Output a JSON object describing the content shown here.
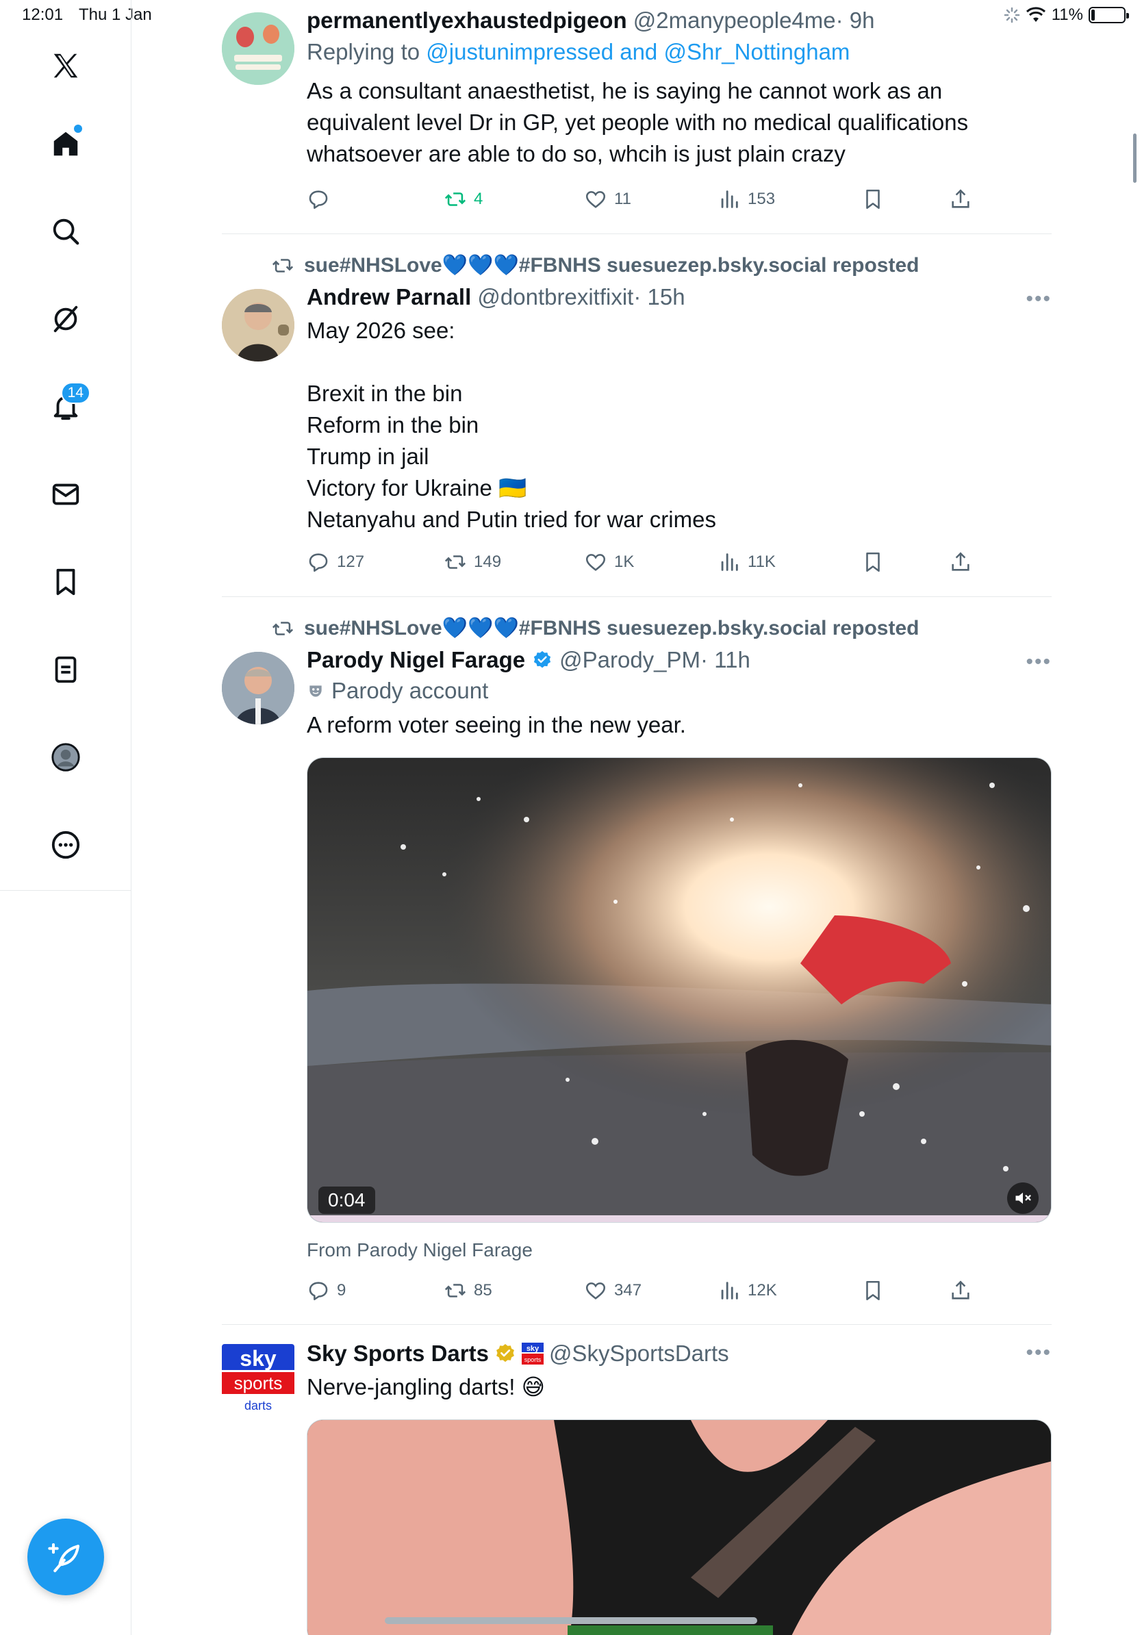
{
  "status_bar": {
    "time": "12:01",
    "date": "Thu 1 Jan",
    "battery": "11%",
    "battery_level": 0.11
  },
  "sidebar": {
    "items": [
      {
        "icon": "x-logo-icon",
        "label": "X"
      },
      {
        "icon": "home-icon",
        "label": "Home"
      },
      {
        "icon": "search-icon",
        "label": "Search"
      },
      {
        "icon": "grok-icon",
        "label": "Grok"
      },
      {
        "icon": "bell-icon",
        "label": "Notifications",
        "badge": "14"
      },
      {
        "icon": "mail-icon",
        "label": "Messages"
      },
      {
        "icon": "bookmark-icon",
        "label": "Bookmarks"
      },
      {
        "icon": "list-icon",
        "label": "Lists"
      },
      {
        "icon": "profile-icon",
        "label": "Profile"
      },
      {
        "icon": "more-icon",
        "label": "More"
      }
    ],
    "compose_icon": "compose-feather-icon"
  },
  "colors": {
    "accent": "#1d9bf0",
    "text": "#0f1419",
    "muted": "#536471",
    "repost_green": "#00ba7c"
  },
  "tweets": [
    {
      "name": "permanentlyexhaustedpigeon",
      "handle": "@2manypeople4me",
      "time": "· 9h",
      "reply_prefix": "Replying to",
      "reply_to": "@justunimpressed and @Shr_Nottingham",
      "text": "As a consultant anaesthetist, he is saying he cannot work as an equivalent level Dr in GP, yet people with no medical qualifications whatsoever are able to do so, whcih is just plain crazy",
      "replies": "",
      "reposts": "4",
      "likes": "11",
      "views": "153"
    },
    {
      "repost_by": "sue#NHSLove💙💙💙#FBNHS suesuezep.bsky.social reposted",
      "name": "Andrew Parnall",
      "handle": "@dontbrexitfixit",
      "time": "· 15h",
      "text": "May 2026 see:\n\nBrexit in the bin\nReform in the bin\nTrump in jail\nVictory for Ukraine 🇺🇦\nNetanyahu and Putin tried for war crimes",
      "replies": "127",
      "reposts": "149",
      "likes": "1K",
      "views": "11K"
    },
    {
      "repost_by": "sue#NHSLove💙💙💙#FBNHS suesuezep.bsky.social reposted",
      "name": "Parody Nigel Farage",
      "handle": "@Parody_PM",
      "time": "· 11h",
      "parody_label": "Parody account",
      "text": "A reform voter seeing in the new year.",
      "video_time": "0:04",
      "from_line": "From Parody Nigel Farage",
      "replies": "9",
      "reposts": "85",
      "likes": "347",
      "views": "12K"
    },
    {
      "name": "Sky Sports Darts",
      "handle": "@SkySportsDarts",
      "text": "Nerve-jangling darts! 😅",
      "avatar_text": {
        "line1": "sky",
        "line2": "sports",
        "line3": "darts"
      },
      "badge_text": {
        "line1": "sky",
        "line2": "sports"
      }
    }
  ]
}
